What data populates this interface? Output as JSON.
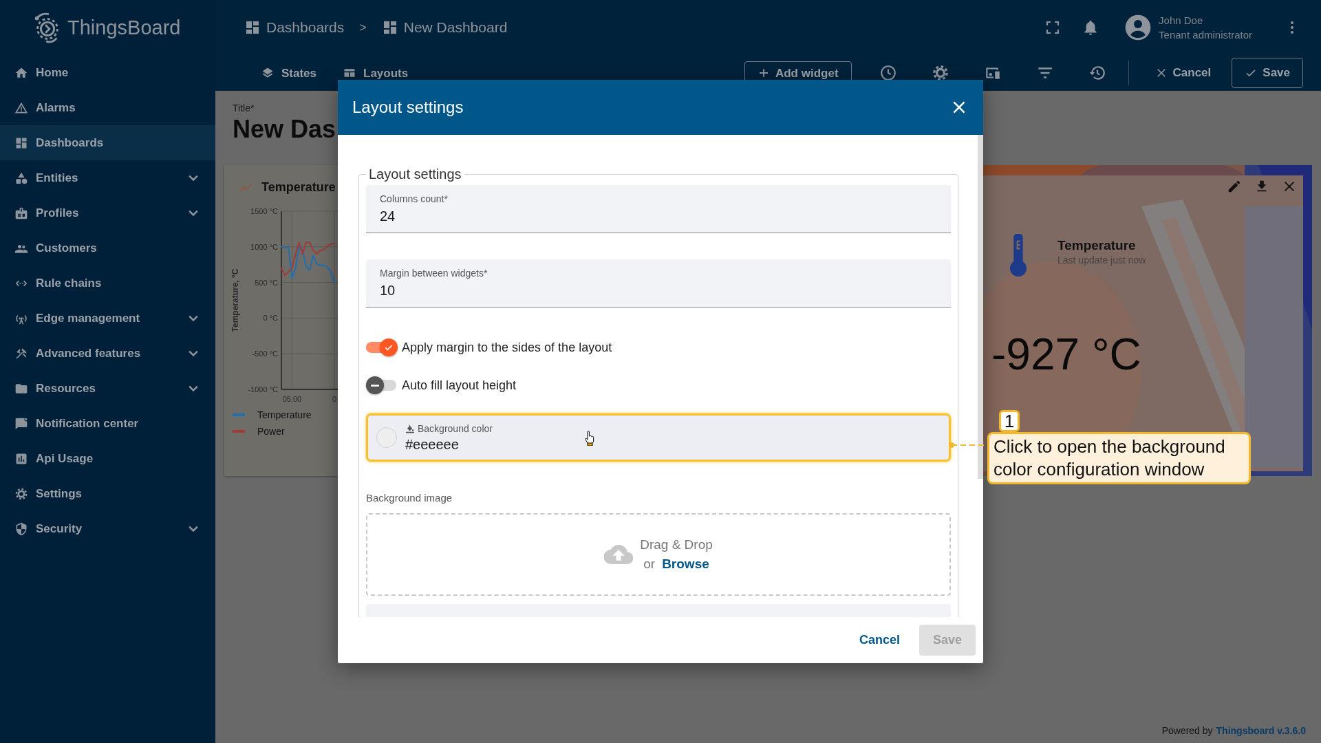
{
  "app": {
    "name": "ThingsBoard"
  },
  "breadcrumb": {
    "items": [
      "Dashboards",
      "New Dashboard"
    ],
    "separator": ">"
  },
  "user": {
    "name": "John Doe",
    "role": "Tenant administrator"
  },
  "sidebar": {
    "items": [
      {
        "label": "Home",
        "selected": false,
        "expandable": false
      },
      {
        "label": "Alarms",
        "selected": false,
        "expandable": false
      },
      {
        "label": "Dashboards",
        "selected": true,
        "expandable": false
      },
      {
        "label": "Entities",
        "selected": false,
        "expandable": true
      },
      {
        "label": "Profiles",
        "selected": false,
        "expandable": true
      },
      {
        "label": "Customers",
        "selected": false,
        "expandable": false
      },
      {
        "label": "Rule chains",
        "selected": false,
        "expandable": false
      },
      {
        "label": "Edge management",
        "selected": false,
        "expandable": true
      },
      {
        "label": "Advanced features",
        "selected": false,
        "expandable": true
      },
      {
        "label": "Resources",
        "selected": false,
        "expandable": true
      },
      {
        "label": "Notification center",
        "selected": false,
        "expandable": false
      },
      {
        "label": "Api Usage",
        "selected": false,
        "expandable": false
      },
      {
        "label": "Settings",
        "selected": false,
        "expandable": false
      },
      {
        "label": "Security",
        "selected": false,
        "expandable": true
      }
    ]
  },
  "toolbar": {
    "tabs": [
      "States",
      "Layouts"
    ],
    "add_widget": "Add widget",
    "cancel": "Cancel",
    "save": "Save"
  },
  "dashboard": {
    "title_label": "Title*",
    "title": "New Das",
    "chart_widget": {
      "title": "Temperature",
      "chart_data": {
        "type": "line",
        "ylabel": "Temperature, °C",
        "categories": [
          null,
          null,
          null,
          "05:00",
          null,
          null,
          null,
          null,
          null,
          null,
          null,
          null,
          null,
          null,
          null,
          "0"
        ],
        "ylim": [
          -1000,
          1500
        ],
        "grid": true,
        "yticks": [
          {
            "value": 1500,
            "label": "1500 °C"
          },
          {
            "value": 1000,
            "label": "1000 °C"
          },
          {
            "value": 500,
            "label": "500 °C"
          },
          {
            "value": 0,
            "label": "0 °C"
          },
          {
            "value": -500,
            "label": "-500 °C"
          },
          {
            "value": -1000,
            "label": "-1000 °C"
          }
        ],
        "series": [
          {
            "name": "Temperature",
            "color": "#1f6fb0",
            "values": [
              1000,
              990,
              990,
              560,
              700,
              1000,
              950,
              720,
              680,
              880,
              760,
              740,
              740,
              720,
              650,
              500
            ]
          },
          {
            "name": "Power",
            "color": "#a33a35",
            "values": [
              700,
              600,
              650,
              700,
              900,
              1060,
              900,
              1060,
              1060,
              950,
              900,
              950,
              960,
              1010,
              1040,
              1050
            ]
          }
        ]
      }
    },
    "value_widget": {
      "kind": "picture",
      "title": "Temperature",
      "subtitle": "Last update just now",
      "value": "-927 °C"
    }
  },
  "dialog": {
    "title": "Layout settings",
    "section": "Layout settings",
    "fields": [
      {
        "label": "Columns count*",
        "value": "24"
      },
      {
        "label": "Margin between widgets*",
        "value": "10"
      }
    ],
    "toggles": [
      {
        "label": "Apply margin to the sides of the layout",
        "on": true
      },
      {
        "label": "Auto fill layout height",
        "on": false
      }
    ],
    "color_field": {
      "label": "Background color",
      "value": "#eeeeee"
    },
    "image": {
      "label": "Background image",
      "drop": "Drag & Drop",
      "or": "or",
      "browse": "Browse"
    },
    "cancel": "Cancel",
    "save": "Save",
    "save_disabled": true
  },
  "annotation": {
    "number": "1",
    "text": "Click to open the background color configuration window"
  },
  "footer": {
    "prefix": "Powered by",
    "link": "Thingsboard v.3.6.0"
  }
}
